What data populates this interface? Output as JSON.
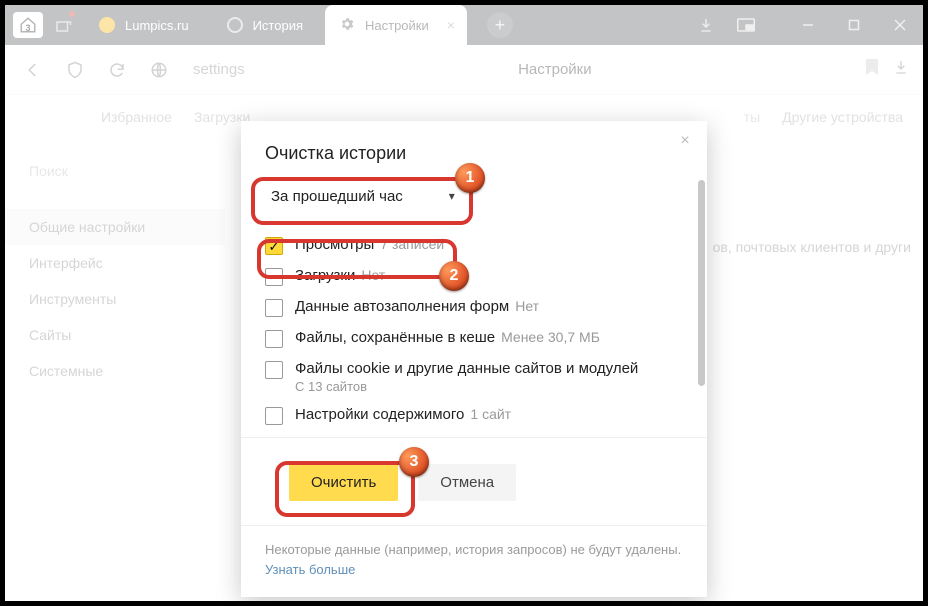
{
  "window": {
    "tab_count": "3"
  },
  "tabs": {
    "lumpics": "Lumpics.ru",
    "history": "История",
    "settings": "Настройки"
  },
  "addressbar": {
    "url": "settings",
    "page_title": "Настройки"
  },
  "subtabs": {
    "favorites": "Избранное",
    "downloads": "Загрузки",
    "right1": "ты",
    "right2": "Другие устройства"
  },
  "sidebar": {
    "search_placeholder": "Поиск",
    "items": [
      "Общие настройки",
      "Интерфейс",
      "Инструменты",
      "Сайты",
      "Системные"
    ]
  },
  "bg_fragment": "ов, почтовых клиентов и други",
  "dialog": {
    "title": "Очистка истории",
    "time_range": "За прошедший час",
    "options": [
      {
        "label": "Просмотры",
        "sub": "7 записей",
        "checked": true
      },
      {
        "label": "Загрузки",
        "sub": "Нет",
        "checked": false
      },
      {
        "label": "Данные автозаполнения форм",
        "sub": "Нет",
        "checked": false
      },
      {
        "label": "Файлы, сохранённые в кеше",
        "sub": "Менее 30,7 МБ",
        "checked": false
      },
      {
        "label": "Файлы cookie и другие данные сайтов и модулей",
        "subline": "С 13 сайтов",
        "checked": false
      },
      {
        "label": "Настройки содержимого",
        "sub": "1 сайт",
        "checked": false
      }
    ],
    "clear_btn": "Очистить",
    "cancel_btn": "Отмена",
    "note_text": "Некоторые данные (например, история запросов) не будут удалены.",
    "note_link": "Узнать больше"
  },
  "callouts": {
    "c1": "1",
    "c2": "2",
    "c3": "3"
  }
}
